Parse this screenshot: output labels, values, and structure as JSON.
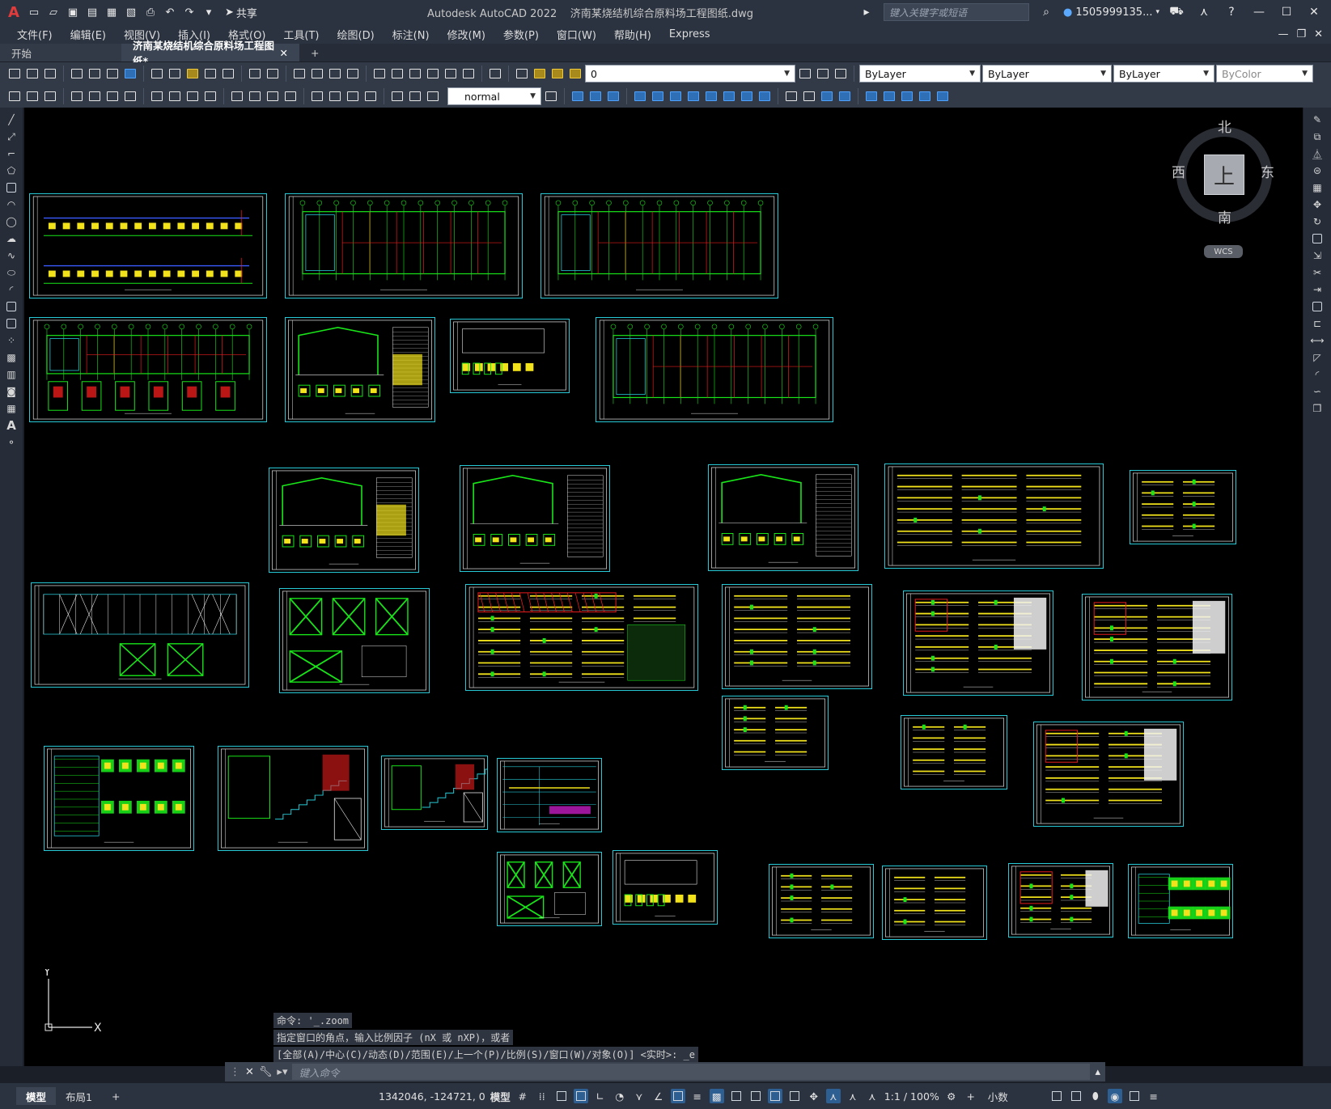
{
  "app": {
    "title": "Autodesk AutoCAD 2022",
    "document": "济南某烧结机综合原料场工程图纸.dwg",
    "logo": "A",
    "share": "共享"
  },
  "search": {
    "placeholder": "键入关键字或短语"
  },
  "user": {
    "name": "1505999135..."
  },
  "menu": [
    "文件(F)",
    "编辑(E)",
    "视图(V)",
    "插入(I)",
    "格式(O)",
    "工具(T)",
    "绘图(D)",
    "标注(N)",
    "修改(M)",
    "参数(P)",
    "窗口(W)",
    "帮助(H)",
    "Express"
  ],
  "tabs": {
    "start": "开始",
    "active": "济南某烧结机综合原料场工程图纸*",
    "add": "+"
  },
  "properties": {
    "layer": "0",
    "color": "ByLayer",
    "linetype": "ByLayer",
    "lineweight": "ByLayer",
    "plotstyle": "ByColor",
    "textstyle": "normal"
  },
  "viewcube": {
    "north": "北",
    "south": "南",
    "east": "东",
    "west": "西",
    "face": "上",
    "wcs": "WCS"
  },
  "ucs": {
    "x": "X",
    "y": "Y"
  },
  "command": {
    "history": [
      "命令: '_.zoom",
      "指定窗口的角点，输入比例因子 (nX 或 nXP)，或者",
      "[全部(A)/中心(C)/动态(D)/范围(E)/上一个(P)/比例(S)/窗口(W)/对象(O)] <实时>: _e"
    ],
    "placeholder": "键入命令"
  },
  "status": {
    "model_tab": "模型",
    "layout_tab": "布局1",
    "coords": "1342046, -124721, 0",
    "space": "模型",
    "scale": "1:1 / 100%",
    "units": "小数"
  },
  "colors": {
    "sheet_border": "#27c9d6",
    "green": "#19e619",
    "yellow": "#f2e21b",
    "red": "#e81c1c",
    "white": "#e8e8e8",
    "cyan": "#27c9d6"
  }
}
